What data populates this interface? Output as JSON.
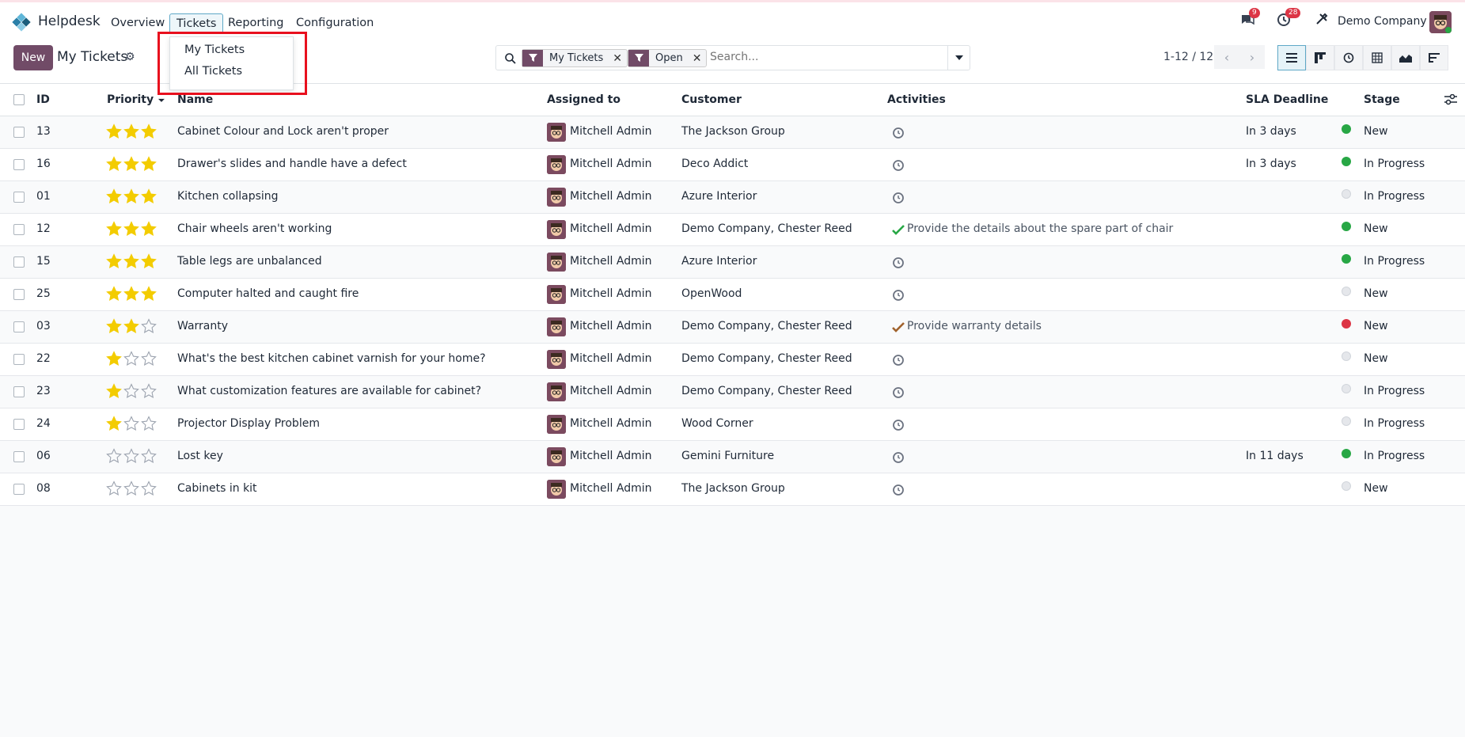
{
  "nav": {
    "app_name": "Helpdesk",
    "menu": [
      "Overview",
      "Tickets",
      "Reporting",
      "Configuration"
    ],
    "messages_count": "9",
    "activities_count": "28",
    "company": "Demo Company"
  },
  "dropdown": {
    "items": [
      "My Tickets",
      "All Tickets"
    ]
  },
  "control": {
    "new_label": "New",
    "title": "My Tickets",
    "facets": [
      "My Tickets",
      "Open"
    ],
    "search_placeholder": "Search...",
    "pager": "1-12 / 12"
  },
  "columns": {
    "id": "ID",
    "priority": "Priority",
    "name": "Name",
    "assigned": "Assigned to",
    "customer": "Customer",
    "activities": "Activities",
    "sla": "SLA Deadline",
    "stage": "Stage"
  },
  "colors": {
    "accent": "#714b67",
    "star_on": "#f3cc00",
    "dot_green": "#28a745",
    "dot_red": "#dc3545",
    "dot_grey": "#e5e7eb"
  },
  "rows": [
    {
      "id": "13",
      "stars": 3,
      "name": "Cabinet Colour and Lock aren't proper",
      "assigned": "Mitchell Admin",
      "customer": "The Jackson Group",
      "activity": "",
      "activity_icon": "clock",
      "sla": "In 3 days",
      "dot": "green",
      "stage": "New"
    },
    {
      "id": "16",
      "stars": 3,
      "name": "Drawer's slides and handle have a defect",
      "assigned": "Mitchell Admin",
      "customer": "Deco Addict",
      "activity": "",
      "activity_icon": "clock",
      "sla": "In 3 days",
      "dot": "green",
      "stage": "In Progress"
    },
    {
      "id": "01",
      "stars": 3,
      "name": "Kitchen collapsing",
      "assigned": "Mitchell Admin",
      "customer": "Azure Interior",
      "activity": "",
      "activity_icon": "clock",
      "sla": "",
      "dot": "grey",
      "stage": "In Progress"
    },
    {
      "id": "12",
      "stars": 3,
      "name": "Chair wheels aren't working",
      "assigned": "Mitchell Admin",
      "customer": "Demo Company, Chester Reed",
      "activity": "Provide the details about the spare part of chair",
      "activity_icon": "check-green",
      "sla": "",
      "dot": "green",
      "stage": "New"
    },
    {
      "id": "15",
      "stars": 3,
      "name": "Table legs are unbalanced",
      "assigned": "Mitchell Admin",
      "customer": "Azure Interior",
      "activity": "",
      "activity_icon": "clock",
      "sla": "",
      "dot": "green",
      "stage": "In Progress"
    },
    {
      "id": "25",
      "stars": 3,
      "name": "Computer halted and caught fire",
      "assigned": "Mitchell Admin",
      "customer": "OpenWood",
      "activity": "",
      "activity_icon": "clock",
      "sla": "",
      "dot": "grey",
      "stage": "New"
    },
    {
      "id": "03",
      "stars": 2,
      "name": "Warranty",
      "assigned": "Mitchell Admin",
      "customer": "Demo Company, Chester Reed",
      "activity": "Provide warranty details",
      "activity_icon": "check-orange",
      "sla": "",
      "dot": "red",
      "stage": "New"
    },
    {
      "id": "22",
      "stars": 1,
      "name": "What's the best kitchen cabinet varnish for your home?",
      "assigned": "Mitchell Admin",
      "customer": "Demo Company, Chester Reed",
      "activity": "",
      "activity_icon": "clock",
      "sla": "",
      "dot": "grey",
      "stage": "New"
    },
    {
      "id": "23",
      "stars": 1,
      "name": "What customization features are available for cabinet?",
      "assigned": "Mitchell Admin",
      "customer": "Demo Company, Chester Reed",
      "activity": "",
      "activity_icon": "clock",
      "sla": "",
      "dot": "grey",
      "stage": "In Progress"
    },
    {
      "id": "24",
      "stars": 1,
      "name": "Projector Display Problem",
      "assigned": "Mitchell Admin",
      "customer": "Wood Corner",
      "activity": "",
      "activity_icon": "clock",
      "sla": "",
      "dot": "grey",
      "stage": "In Progress"
    },
    {
      "id": "06",
      "stars": 0,
      "name": "Lost key",
      "assigned": "Mitchell Admin",
      "customer": "Gemini Furniture",
      "activity": "",
      "activity_icon": "clock",
      "sla": "In 11 days",
      "dot": "green",
      "stage": "In Progress"
    },
    {
      "id": "08",
      "stars": 0,
      "name": "Cabinets in kit",
      "assigned": "Mitchell Admin",
      "customer": "The Jackson Group",
      "activity": "",
      "activity_icon": "clock",
      "sla": "",
      "dot": "grey",
      "stage": "New"
    }
  ]
}
